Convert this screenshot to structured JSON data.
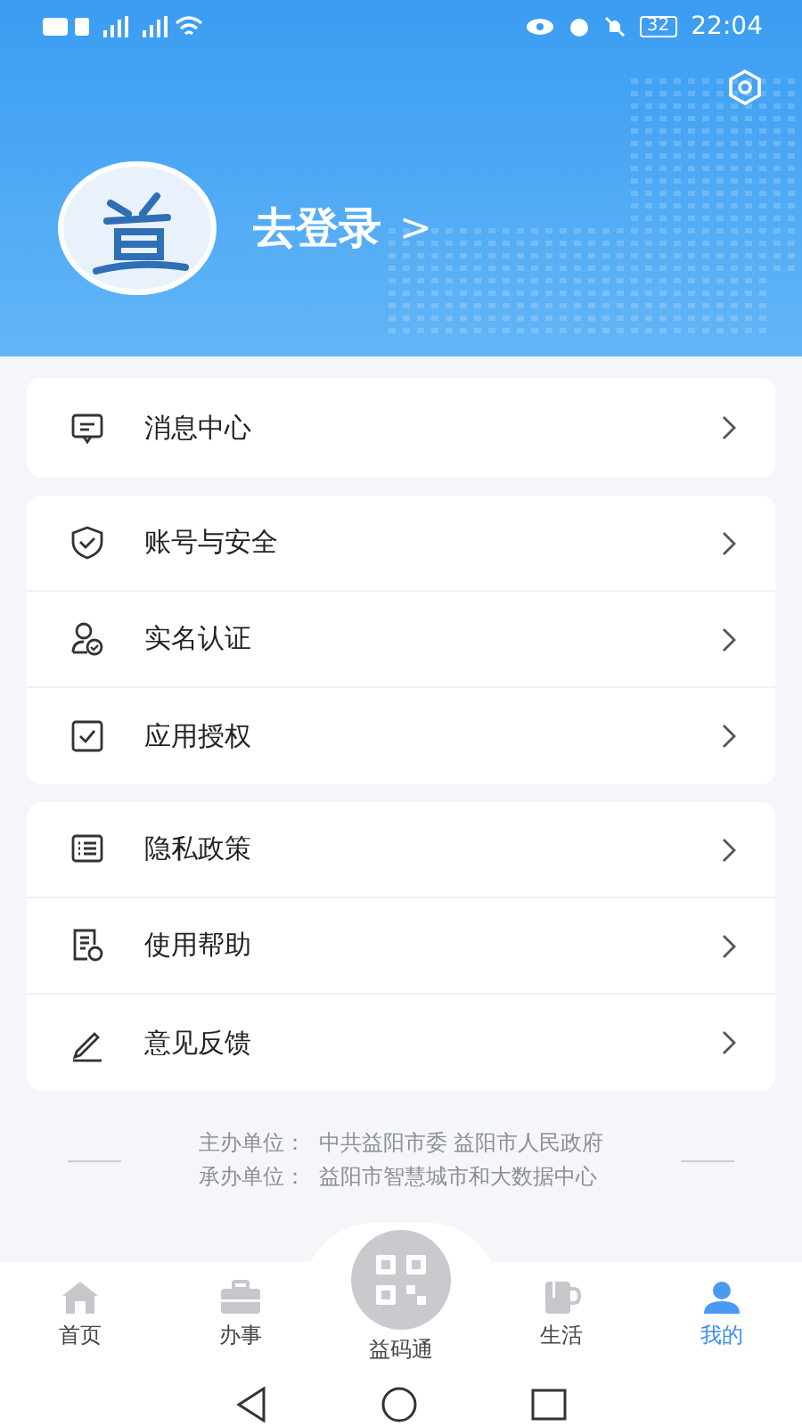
{
  "status_bar": {
    "battery": "32",
    "time": "22:04"
  },
  "profile": {
    "login_label": "去登录",
    "chevron": ">"
  },
  "menu_groups": [
    {
      "items": [
        {
          "label": "消息中心",
          "kind": "message"
        }
      ]
    },
    {
      "items": [
        {
          "label": "账号与安全",
          "kind": "shield"
        },
        {
          "label": "实名认证",
          "kind": "person"
        },
        {
          "label": "应用授权",
          "kind": "check"
        }
      ]
    },
    {
      "items": [
        {
          "label": "隐私政策",
          "kind": "list"
        },
        {
          "label": "使用帮助",
          "kind": "help"
        },
        {
          "label": "意见反馈",
          "kind": "pen"
        }
      ]
    }
  ],
  "footer": {
    "lines": [
      "主办单位：  中共益阳市委 益阳市人民政府",
      "承办单位：  益阳市智慧城市和大数据中心"
    ]
  },
  "tab_bar": [
    {
      "label": "首页",
      "kind": "home",
      "selected": false
    },
    {
      "label": "办事",
      "kind": "briefcase",
      "selected": false
    },
    {
      "label": "益码通",
      "kind": "qr",
      "selected": false
    },
    {
      "label": "生活",
      "kind": "cup",
      "selected": false
    },
    {
      "label": "我的",
      "kind": "user",
      "selected": true
    }
  ]
}
